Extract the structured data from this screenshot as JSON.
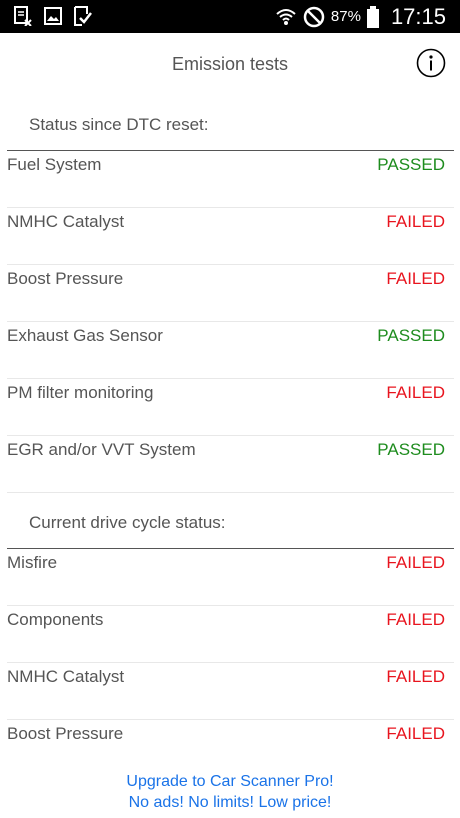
{
  "status_bar": {
    "battery_percent": "87%",
    "time": "17:15",
    "icons": [
      "edit-doc-icon",
      "image-icon",
      "check-doc-icon",
      "wifi-icon",
      "do-not-disturb-icon",
      "battery-icon"
    ]
  },
  "header": {
    "title": "Emission tests",
    "info_icon": "info-icon"
  },
  "sections": [
    {
      "title": "Status since DTC reset:",
      "rows": [
        {
          "name": "Fuel System",
          "status": "PASSED"
        },
        {
          "name": "NMHC Catalyst",
          "status": "FAILED"
        },
        {
          "name": "Boost Pressure",
          "status": "FAILED"
        },
        {
          "name": "Exhaust Gas Sensor",
          "status": "PASSED"
        },
        {
          "name": "PM filter monitoring",
          "status": "FAILED"
        },
        {
          "name": "EGR and/or VVT System",
          "status": "PASSED"
        }
      ]
    },
    {
      "title": "Current drive cycle status:",
      "rows": [
        {
          "name": "Misfire",
          "status": "FAILED"
        },
        {
          "name": "Components",
          "status": "FAILED"
        },
        {
          "name": "NMHC Catalyst",
          "status": "FAILED"
        },
        {
          "name": "Boost Pressure",
          "status": "FAILED"
        }
      ]
    }
  ],
  "promo": {
    "line1": "Upgrade to Car Scanner Pro!",
    "line2": "No ads! No limits! Low price!"
  },
  "colors": {
    "passed": "#1e8c1e",
    "failed": "#e8141e",
    "link": "#1a73e8",
    "text": "#555555"
  }
}
